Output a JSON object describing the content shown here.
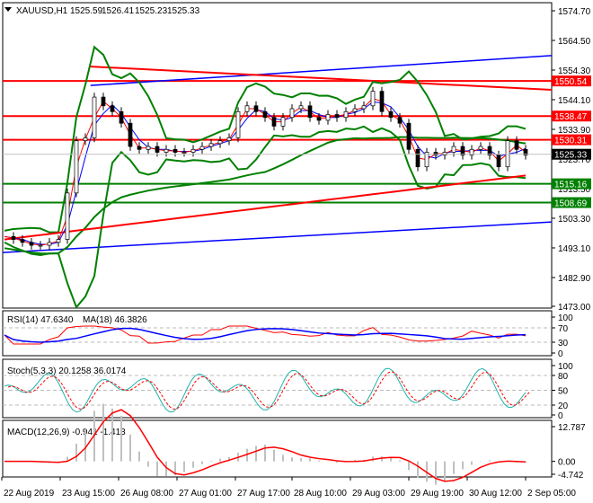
{
  "chart_data": {
    "type": "line",
    "title": "XAUUSD,H1",
    "ohlc": {
      "open": "1525.59",
      "high": "1526.41",
      "low": "1525.23",
      "close": "1525.33"
    },
    "current_price": "1525.33",
    "ylim": [
      1473.0,
      1574.7
    ],
    "price_ticks": [
      "1574.70",
      "1564.50",
      "1554.30",
      "1544.10",
      "1533.90",
      "1523.70",
      "1513.50",
      "1503.30",
      "1493.10",
      "1482.90",
      "1473.00"
    ],
    "xtick_labels": [
      "22 Aug 2019",
      "23 Aug 15:00",
      "26 Aug 08:00",
      "27 Aug 01:00",
      "27 Aug 17:00",
      "28 Aug 10:00",
      "29 Aug 03:00",
      "29 Aug 19:00",
      "30 Aug 12:00",
      "2 Sep 05:00"
    ],
    "closes": [
      1497,
      1496,
      1495,
      1494,
      1494,
      1495,
      1496,
      1512,
      1530,
      1531,
      1545,
      1542,
      1540,
      1536,
      1528,
      1527,
      1528,
      1526,
      1527,
      1526,
      1526,
      1527,
      1528,
      1529,
      1530,
      1531,
      1540,
      1542,
      1540,
      1538,
      1535,
      1538,
      1541,
      1542,
      1538,
      1537,
      1539,
      1538,
      1540,
      1541,
      1542,
      1547,
      1540,
      1538,
      1536,
      1527,
      1521,
      1526,
      1525,
      1526,
      1528,
      1525,
      1527,
      1528,
      1525,
      1521,
      1530,
      1527,
      1525
    ],
    "resistance_levels": [
      {
        "value": 1550.54,
        "label": "1550.54"
      },
      {
        "value": 1538.47,
        "label": "1538.47"
      },
      {
        "value": 1530.31,
        "label": "1530.31"
      }
    ],
    "support_levels": [
      {
        "value": 1515.16,
        "label": "1515.16"
      },
      {
        "value": 1508.69,
        "label": "1508.69"
      }
    ],
    "trendlines": [
      {
        "color": "#0000ff",
        "from": [
          0,
          1491.5
        ],
        "to": [
          1,
          1502.0
        ]
      },
      {
        "color": "#0000ff",
        "from": [
          0.16,
          1549.0
        ],
        "to": [
          1,
          1559.3
        ]
      },
      {
        "color": "#ff0000",
        "from": [
          0.16,
          1555.5
        ],
        "to": [
          1,
          1547.5
        ]
      }
    ],
    "colors": {
      "resistance": "#ff0000",
      "support": "#008000",
      "price_box": "#000000"
    },
    "rsi": {
      "label": "RSI(14) 47.6340",
      "ma_label": "MA(18) 46.3826",
      "ticks": [
        "100",
        "70",
        "30",
        "0"
      ]
    },
    "stoch": {
      "label": "Stoch(5,3,3) 20.1258 36.0174",
      "ticks": [
        "100",
        "80",
        "50",
        "20",
        "0"
      ]
    },
    "macd": {
      "label": "MACD(12,26,9) -0.941 -1.413",
      "ticks": [
        "12.787",
        "0.00",
        "-4.742"
      ]
    }
  }
}
